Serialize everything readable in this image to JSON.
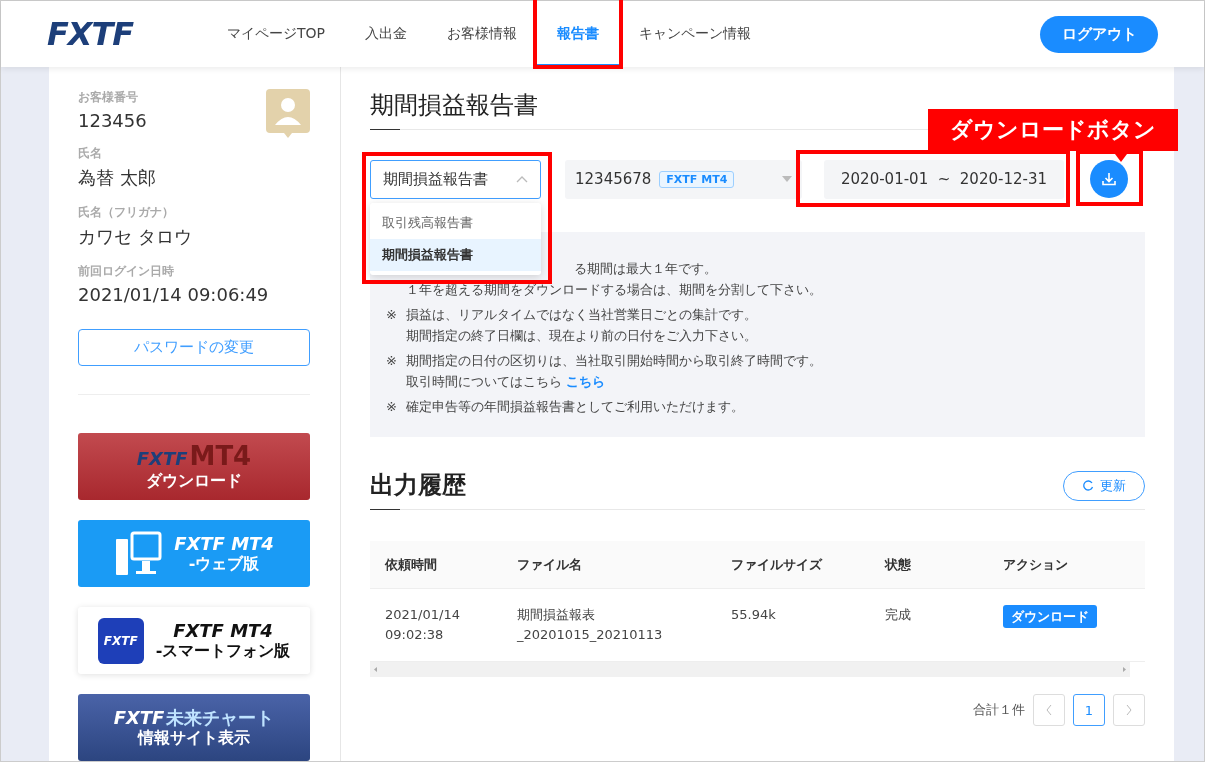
{
  "header": {
    "logo": "FXTF",
    "nav": [
      {
        "label": "マイページTOP",
        "selected": false,
        "highlighted": false
      },
      {
        "label": "入出金",
        "selected": false,
        "highlighted": false
      },
      {
        "label": "お客様情報",
        "selected": false,
        "highlighted": false
      },
      {
        "label": "報告書",
        "selected": true,
        "highlighted": true
      },
      {
        "label": "キャンペーン情報",
        "selected": false,
        "highlighted": false
      }
    ],
    "logout": "ログアウト"
  },
  "sidebar": {
    "fields": [
      {
        "label": "お客様番号",
        "value": "123456"
      },
      {
        "label": "氏名",
        "value": "為替 太郎"
      },
      {
        "label": "氏名（フリガナ）",
        "value": "カワセ タロウ"
      },
      {
        "label": "前回ログイン日時",
        "value": "2021/01/14 09:06:49"
      }
    ],
    "password_button": "パスワードの変更",
    "banners": [
      {
        "kind": "download",
        "logo": "FXTF",
        "title": "MT4",
        "subtitle": "ダウンロード"
      },
      {
        "kind": "web",
        "logo": "FXTF MT4",
        "subtitle": "-ウェブ版"
      },
      {
        "kind": "phone",
        "icon_text": "FXTF",
        "logo": "FXTF MT4",
        "subtitle": "-スマートフォン版"
      },
      {
        "kind": "chart",
        "logo": "FXTF",
        "title": "未来チャート",
        "subtitle": "情報サイト表示"
      }
    ]
  },
  "report": {
    "title": "期間損益報告書",
    "report_select": {
      "value": "期間損益報告書",
      "expanded": true,
      "highlighted": true,
      "options": [
        {
          "label": "取引残高報告書",
          "selected": false
        },
        {
          "label": "期間損益報告書",
          "selected": true
        }
      ]
    },
    "account_select": {
      "number": "12345678",
      "badge": "FXTF MT4"
    },
    "date_range": {
      "value": "2020-01-01  ~  2020-12-31",
      "highlighted": true
    },
    "download_button": {
      "highlighted": true
    },
    "callout": "ダウンロードボタン",
    "notes": [
      {
        "lines": [
          "る期間は最大１年です。",
          "１年を超える期間をダウンロードする場合は、期間を分割して下さい。"
        ]
      },
      {
        "mark": "※",
        "lines": [
          "損益は、リアルタイムではなく当社営業日ごとの集計です。",
          "期間指定の終了日欄は、現在より前の日付をご入力下さい。"
        ]
      },
      {
        "mark": "※",
        "lines": [
          "期間指定の日付の区切りは、当社取引開始時間から取引終了時間です。",
          "取引時間についてはこちら"
        ],
        "link": "こちら"
      },
      {
        "mark": "※",
        "lines": [
          "確定申告等の年間損益報告書としてご利用いただけます。"
        ]
      }
    ]
  },
  "history": {
    "title": "出力履歴",
    "refresh": "更新",
    "columns": [
      "依頼時間",
      "ファイル名",
      "ファイルサイズ",
      "状態",
      "アクション"
    ],
    "rows": [
      {
        "time": [
          "2021/01/14",
          "09:02:38"
        ],
        "file": [
          "期間損益報表",
          "_20201015_20210113"
        ],
        "size": "55.94k",
        "status": "完成",
        "action": "ダウンロード"
      }
    ],
    "total": "合計１件",
    "pages": [
      {
        "label": "1",
        "selected": true
      }
    ]
  }
}
